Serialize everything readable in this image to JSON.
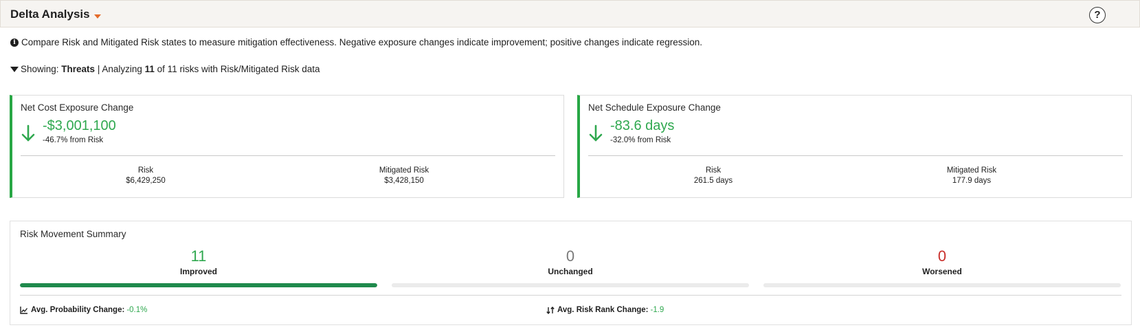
{
  "header": {
    "title": "Delta Analysis",
    "help_label": "?"
  },
  "info": {
    "text": "Compare Risk and Mitigated Risk states to measure mitigation effectiveness. Negative exposure changes indicate improvement; positive changes indicate regression."
  },
  "filter": {
    "prefix": "Showing: ",
    "category": "Threats",
    "middle": " | Analyzing ",
    "count": "11",
    "suffix": " of 11 risks with Risk/Mitigated Risk data"
  },
  "cost_card": {
    "title": "Net Cost Exposure Change",
    "value": "-$3,001,100",
    "pct": "-46.7% from Risk",
    "risk_label": "Risk",
    "risk_value": "$6,429,250",
    "mitigated_label": "Mitigated Risk",
    "mitigated_value": "$3,428,150"
  },
  "schedule_card": {
    "title": "Net Schedule Exposure Change",
    "value": "-83.6 days",
    "pct": "-32.0% from Risk",
    "risk_label": "Risk",
    "risk_value": "261.5 days",
    "mitigated_label": "Mitigated Risk",
    "mitigated_value": "177.9 days"
  },
  "summary": {
    "title": "Risk Movement Summary",
    "improved": {
      "count": "11",
      "label": "Improved",
      "fraction": 1.0,
      "color": "#2fa84f"
    },
    "unchanged": {
      "count": "0",
      "label": "Unchanged",
      "fraction": 0.0,
      "color": "#7a7a7a"
    },
    "worsened": {
      "count": "0",
      "label": "Worsened",
      "fraction": 0.0,
      "color": "#c9302c"
    },
    "avg_prob_label": "Avg. Probability Change:",
    "avg_prob_value": "-0.1%",
    "avg_rank_label": "Avg. Risk Rank Change:",
    "avg_rank_value": "-1.9"
  },
  "colors": {
    "accent_green": "#2fa84f",
    "bar_green": "#1f8a4c",
    "header_caret": "#e46b2a"
  }
}
